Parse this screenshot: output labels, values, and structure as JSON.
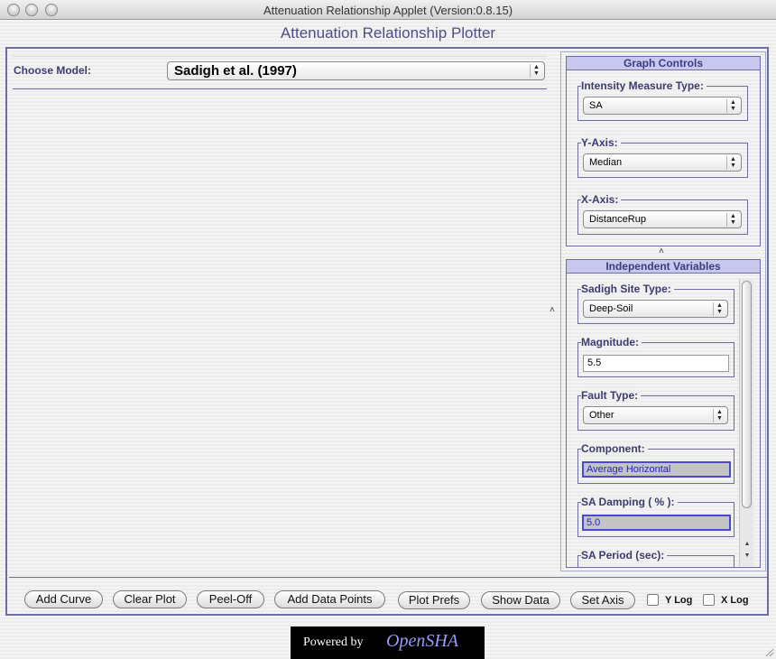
{
  "window": {
    "title": "Attenuation Relationship Applet (Version:0.8.15)"
  },
  "app": {
    "heading": "Attenuation Relationship Plotter"
  },
  "model": {
    "label": "Choose Model:",
    "selected": "Sadigh et al. (1997)"
  },
  "graph_controls": {
    "title": "Graph Controls",
    "intensity_measure_type": {
      "label": "Intensity Measure Type:",
      "value": "SA"
    },
    "y_axis": {
      "label": "Y-Axis:",
      "value": "Median"
    },
    "x_axis": {
      "label": "X-Axis:",
      "value": "DistanceRup"
    }
  },
  "independent_variables": {
    "title": "Independent Variables",
    "site_type": {
      "label": "Sadigh Site Type:",
      "value": "Deep-Soil"
    },
    "magnitude": {
      "label": "Magnitude:",
      "value": "5.5"
    },
    "fault_type": {
      "label": "Fault Type:",
      "value": "Other"
    },
    "component": {
      "label": "Component:",
      "value": "Average Horizontal"
    },
    "sa_damping": {
      "label": "SA Damping ( % ):",
      "value": "5.0"
    },
    "sa_period": {
      "label": "SA Period (sec):"
    }
  },
  "buttons": {
    "add_curve": "Add Curve",
    "clear_plot": "Clear Plot",
    "peel_off": "Peel-Off",
    "add_data_points": "Add Data Points",
    "plot_prefs": "Plot Prefs",
    "show_data": "Show Data",
    "set_axis": "Set Axis"
  },
  "checkboxes": {
    "y_log": "Y Log",
    "x_log": "X Log"
  },
  "footer": {
    "powered_by": "Powered by",
    "brand": "OpenSHA"
  }
}
